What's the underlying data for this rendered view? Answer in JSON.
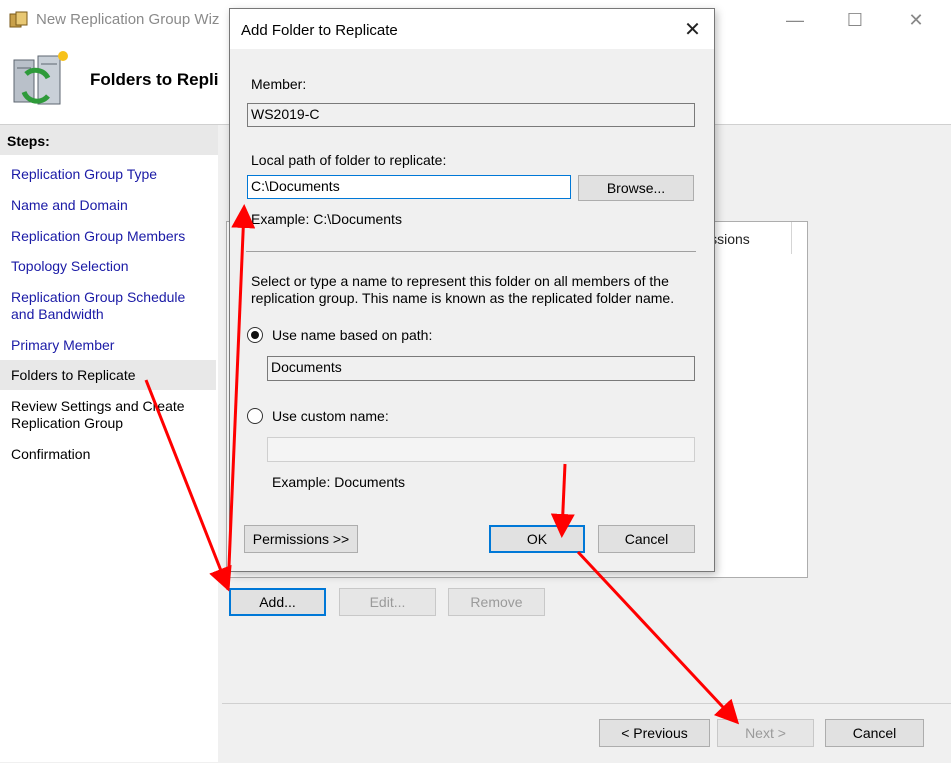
{
  "wizard": {
    "title": "New Replication Group Wiz",
    "heading": "Folders to Repli",
    "steps_label": "Steps:",
    "steps": [
      {
        "label": "Replication Group Type"
      },
      {
        "label": "Name and Domain"
      },
      {
        "label": "Replication Group Members"
      },
      {
        "label": "Topology Selection"
      },
      {
        "label": "Replication Group Schedule and Bandwidth"
      },
      {
        "label": "Primary Member"
      },
      {
        "label": "Folders to Replicate"
      },
      {
        "label": "Review Settings and Create Replication Group"
      },
      {
        "label": "Confirmation"
      }
    ],
    "list_column": "issions",
    "add_label": "Add...",
    "edit_label": "Edit...",
    "remove_label": "Remove",
    "previous_label": "< Previous",
    "next_label": "Next >",
    "cancel_label": "Cancel",
    "minimize_glyph": "—",
    "maximize_glyph": "☐",
    "close_glyph": "✕"
  },
  "dialog": {
    "title": "Add Folder to Replicate",
    "close_glyph": "✕",
    "member_label": "Member:",
    "member_value": "WS2019-C",
    "local_path_label": "Local path of folder to replicate:",
    "local_path_value": "C:\\Documents",
    "browse_label": "Browse...",
    "example_path": "Example: C:\\Documents",
    "description": "Select or type a name to represent this folder on all members of the replication group. This name is known as the replicated folder name.",
    "use_path_label": "Use name based on path:",
    "path_name_value": "Documents",
    "use_custom_label": "Use custom name:",
    "custom_name_value": "",
    "example_name": "Example: Documents",
    "permissions_label": "Permissions >>",
    "ok_label": "OK",
    "cancel_label": "Cancel"
  },
  "annotation_color": "#ff0000",
  "accent_color": "#0078d7",
  "link_color": "#1a1aa6"
}
